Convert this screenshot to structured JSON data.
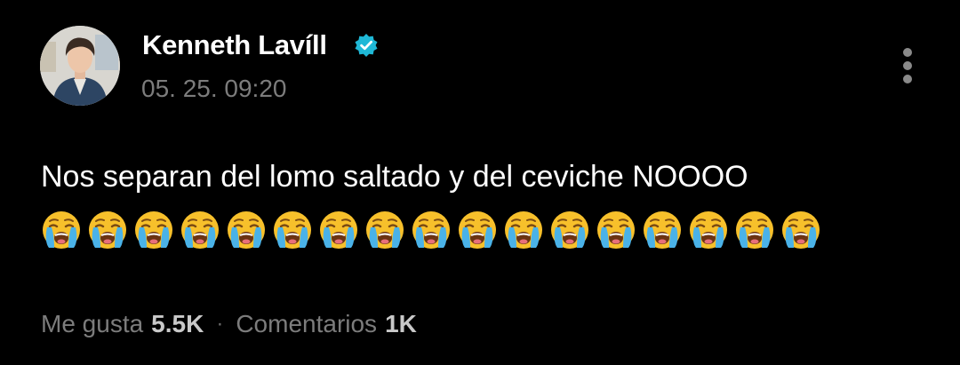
{
  "author": {
    "name": "Kenneth Lavíll",
    "verified": true,
    "verified_color": "#1fb8d6"
  },
  "post": {
    "timestamp": "05. 25. 09:20",
    "text": "Nos separan del lomo saltado y del ceviche NOOOO",
    "emoji": "loudly-crying-face",
    "emoji_count": 17
  },
  "stats": {
    "likes_label": "Me gusta",
    "likes_count": "5.5K",
    "separator": "·",
    "comments_label": "Comentarios",
    "comments_count": "1K"
  },
  "icons": {
    "menu": "more-vertical-icon",
    "verified": "verified-badge-icon"
  },
  "colors": {
    "background": "#000000",
    "text_primary": "#ffffff",
    "text_secondary": "#7c7c7c"
  }
}
